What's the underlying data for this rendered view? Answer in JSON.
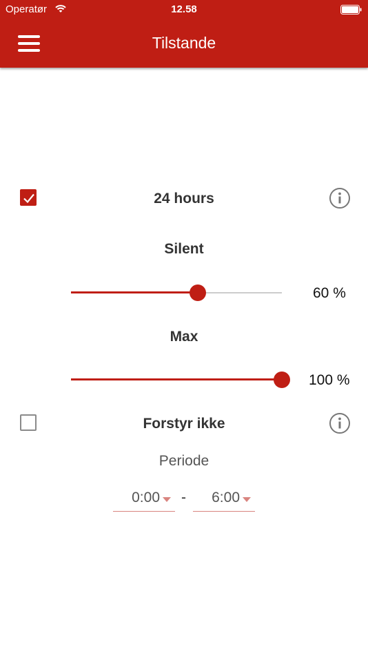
{
  "status_bar": {
    "carrier": "Operatør",
    "time": "12.58"
  },
  "header": {
    "title": "Tilstande"
  },
  "mode_24h": {
    "label": "24 hours",
    "checked": true,
    "silent": {
      "label": "Silent",
      "value": 60,
      "display": "60 %"
    },
    "max": {
      "label": "Max",
      "value": 100,
      "display": "100 %"
    }
  },
  "mode_dnd": {
    "label": "Forstyr ikke",
    "checked": false,
    "period_label": "Periode",
    "start": "0:00",
    "separator": "-",
    "end": "6:00"
  },
  "colors": {
    "accent": "#bf1e14",
    "underline": "#d9847f"
  },
  "icons": [
    "wifi-icon",
    "battery-icon",
    "hamburger-menu-icon",
    "checkmark-icon",
    "info-icon",
    "dropdown-caret-icon"
  ]
}
